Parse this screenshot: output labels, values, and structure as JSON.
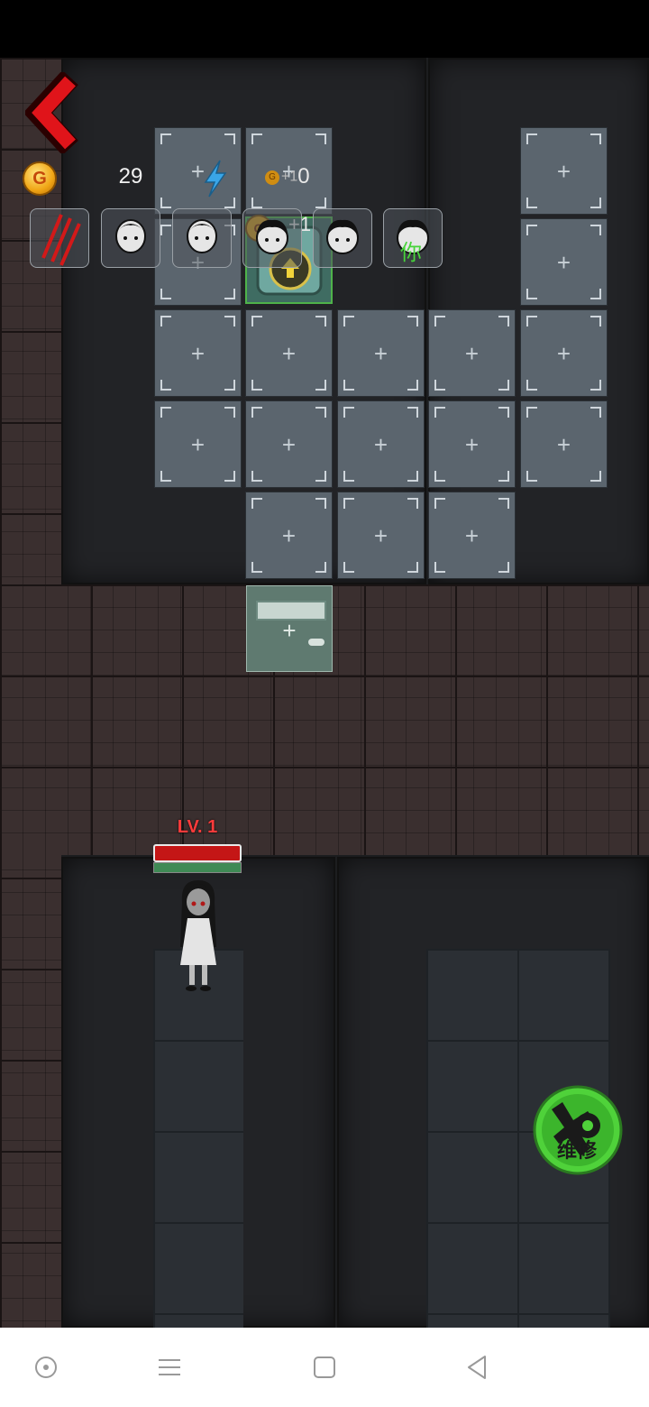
{
  "hud": {
    "gold_icon_letter": "G",
    "gold_count": "29",
    "income_mini": "G",
    "income_plus": "+1",
    "income_value": "0",
    "back_icon": "chevron-left-icon",
    "energy_icon": "lightning-icon"
  },
  "grid": {
    "slot_symbol": "+"
  },
  "bed_overlay": {
    "coin_letter": "G",
    "plus_label": "+1"
  },
  "portrait_badge": "你",
  "enemy": {
    "level_label": "LV. 1"
  },
  "repair_button": {
    "label": "维修",
    "icon": "wrench-gear-icon"
  },
  "colors": {
    "accent_green": "#4fd23a",
    "hp_red": "#c41616",
    "back_red": "#e0141a"
  }
}
